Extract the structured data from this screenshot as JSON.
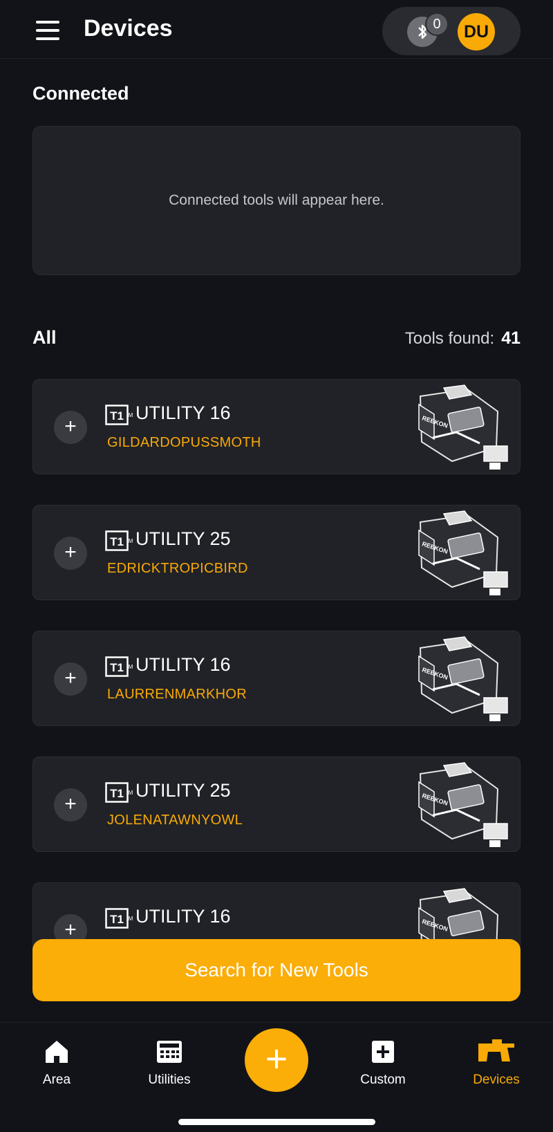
{
  "header": {
    "title": "Devices",
    "bluetooth_count": "0",
    "avatar_initials": "DU"
  },
  "connected": {
    "title": "Connected",
    "empty_text": "Connected tools will appear here."
  },
  "all": {
    "title": "All",
    "tools_found_label": "Tools found:",
    "tools_found_count": "41"
  },
  "tools": [
    {
      "logo": "T1",
      "model": "UTILITY 16",
      "name": "GILDARDOPUSSMOTH"
    },
    {
      "logo": "T1",
      "model": "UTILITY 25",
      "name": "EDRICKTROPICBIRD"
    },
    {
      "logo": "T1",
      "model": "UTILITY 16",
      "name": "LAURRENMARKHOR"
    },
    {
      "logo": "T1",
      "model": "UTILITY 25",
      "name": "JOLENATAWNYOWL"
    },
    {
      "logo": "T1",
      "model": "UTILITY 16",
      "name": ""
    }
  ],
  "search_button": "Search for New Tools",
  "bottom_nav": {
    "items": [
      {
        "label": "Area",
        "icon": "home-icon"
      },
      {
        "label": "Utilities",
        "icon": "calculator-icon"
      },
      {
        "label": "Custom",
        "icon": "add-square-icon"
      },
      {
        "label": "Devices",
        "icon": "devices-icon"
      }
    ],
    "fab_icon": "plus-icon"
  },
  "colors": {
    "accent": "#f9aa06",
    "background": "#111319",
    "card": "#212227"
  }
}
